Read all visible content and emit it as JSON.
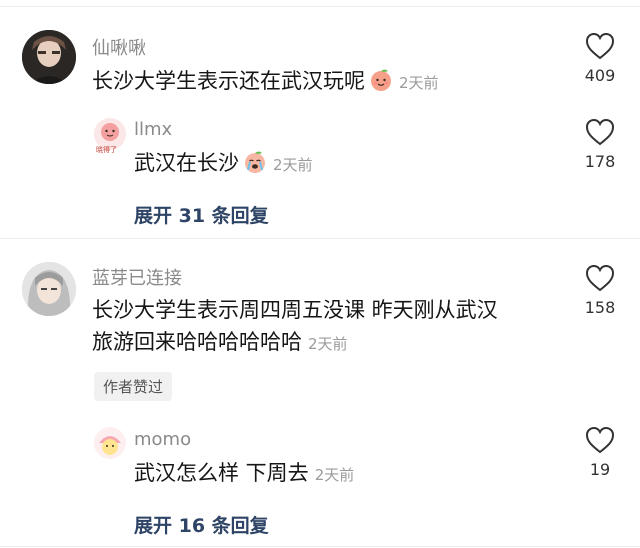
{
  "comments": [
    {
      "username": "仙啾啾",
      "text": "长沙大学生表示还在武汉玩呢",
      "time": "2天前",
      "likes": "409",
      "reply": {
        "username": "llmx",
        "avatar_text": "晓得了",
        "text": "武汉在长沙",
        "time": "2天前",
        "likes": "178"
      },
      "expand_label": "展开 31 条回复"
    },
    {
      "username": "蓝芽已连接",
      "text_line1": "长沙大学生表示周四周五没课 昨天刚从武汉",
      "text_line2": "旅游回来哈哈哈哈哈哈",
      "time": "2天前",
      "likes": "158",
      "badge": "作者赞过",
      "reply": {
        "username": "momo",
        "text": "武汉怎么样 下周去",
        "time": "2天前",
        "likes": "19"
      },
      "expand_label": "展开 16 条回复"
    }
  ],
  "icons": {
    "like": "heart-outline-icon",
    "emoji_peach": "peach-face-emoji",
    "emoji_crying": "crying-face-emoji"
  }
}
